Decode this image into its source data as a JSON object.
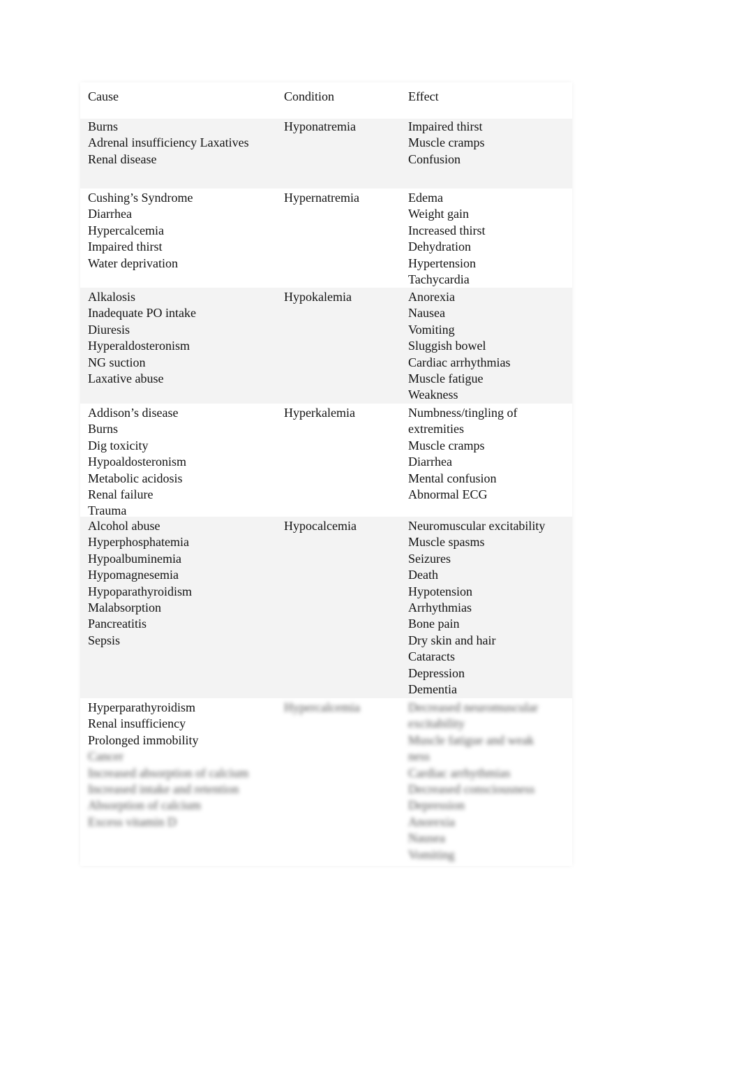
{
  "table": {
    "headers": [
      "Cause",
      "Condition",
      "Effect"
    ],
    "rows": [
      {
        "cause": [
          "Burns",
          "Adrenal insufficiency Laxatives",
          "Renal disease"
        ],
        "condition": "Hyponatremia",
        "effect": [
          "Impaired thirst",
          "Muscle cramps",
          "Confusion"
        ]
      },
      {
        "cause": [
          "Cushing’s Syndrome",
          "Diarrhea",
          "Hypercalcemia",
          "Impaired thirst",
          "Water deprivation"
        ],
        "condition": "Hypernatremia",
        "effect": [
          "Edema",
          "Weight gain",
          "Increased thirst",
          "Dehydration",
          "Hypertension",
          "Tachycardia"
        ]
      },
      {
        "cause": [
          "Alkalosis",
          "Inadequate PO intake",
          "Diuresis",
          "Hyperaldosteronism",
          "NG suction",
          "Laxative abuse"
        ],
        "condition": "Hypokalemia",
        "effect": [
          "Anorexia",
          "Nausea",
          "Vomiting",
          "Sluggish bowel",
          "Cardiac arrhythmias",
          "Muscle fatigue",
          "Weakness"
        ]
      },
      {
        "cause": [
          "Addison’s disease",
          "Burns",
          "Dig toxicity",
          "Hypoaldosteronism",
          "Metabolic acidosis",
          "Renal failure",
          "Trauma"
        ],
        "condition": "Hyperkalemia",
        "effect": [
          "Numbness/tingling of",
          "extremities",
          "Muscle cramps",
          "Diarrhea",
          "Mental confusion",
          "Abnormal ECG"
        ]
      },
      {
        "cause": [
          "Alcohol abuse",
          "Hyperphosphatemia",
          "Hypoalbuminemia",
          "Hypomagnesemia",
          "Hypoparathyroidism",
          "Malabsorption",
          "Pancreatitis",
          "Sepsis"
        ],
        "condition": "Hypocalcemia",
        "effect": [
          "Neuromuscular excitability",
          "Muscle spasms",
          "Seizures",
          "Death",
          "Hypotension",
          "Arrhythmias",
          "Bone pain",
          "Dry skin and hair",
          "Cataracts",
          "Depression",
          "Dementia"
        ]
      },
      {
        "cause": [
          "Hyperparathyroidism",
          "Renal insufficiency",
          "Prolonged immobility",
          "Cancer",
          "Increased absorption of calcium",
          "Increased intake and retention",
          "Absorption of calcium",
          "Excess vitamin D"
        ],
        "condition": "Hypercalcemia",
        "effect": [
          "Decreased neuromuscular",
          "excitability",
          "Muscle fatigue and weak",
          "ness",
          "Cardiac arrhythmias",
          "Decreased consciousness",
          "Depression",
          "Anorexia",
          "Nausea",
          "Vomiting"
        ]
      }
    ]
  }
}
